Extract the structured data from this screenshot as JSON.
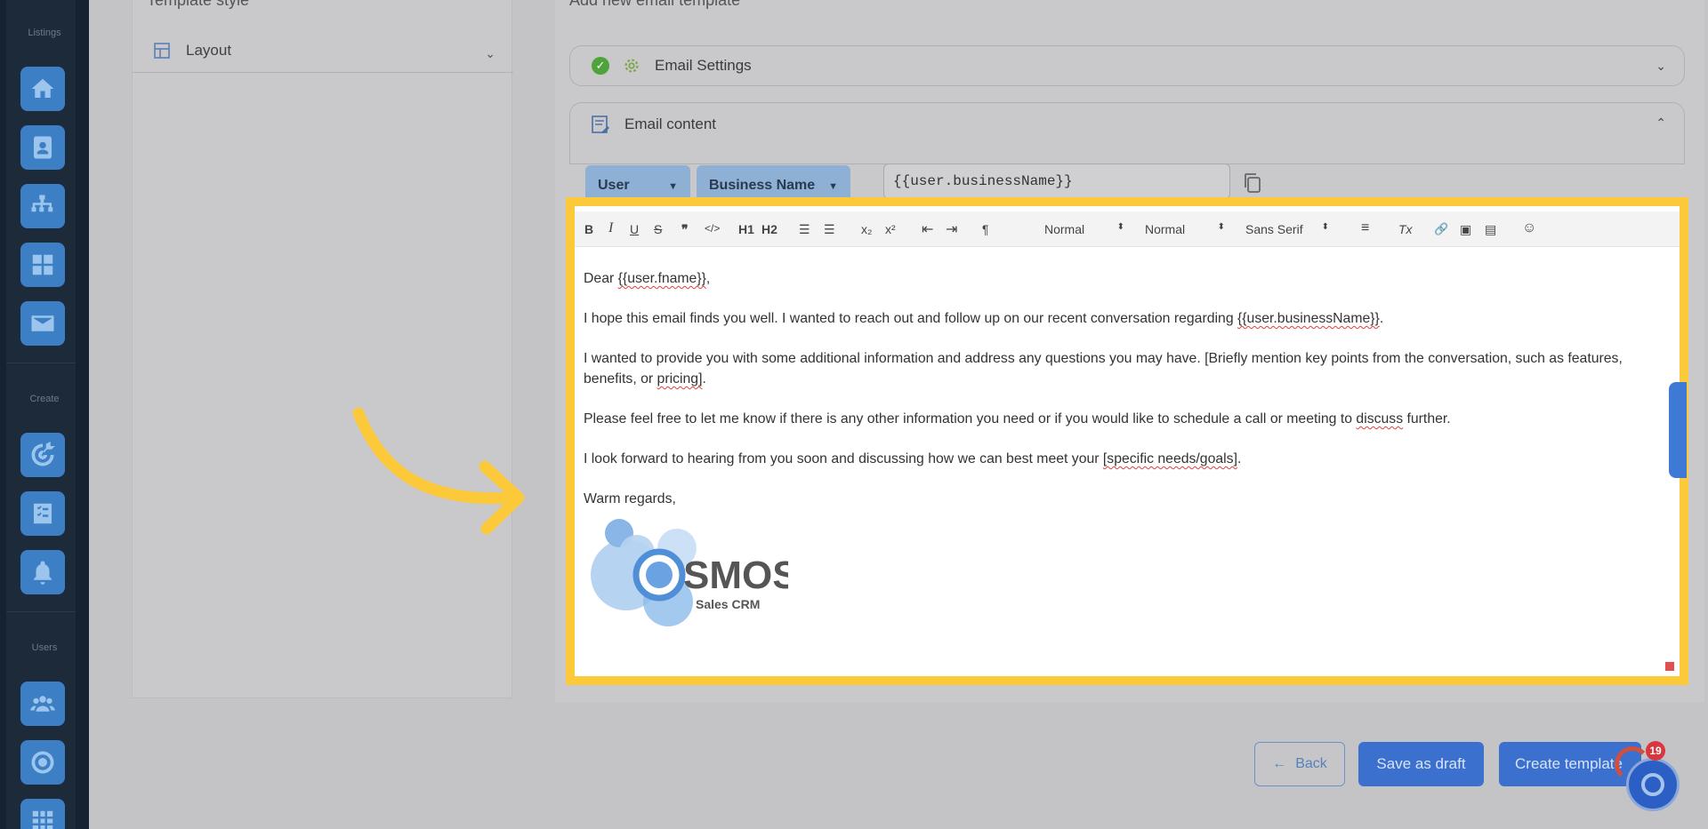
{
  "rail": {
    "sections": [
      "Listings",
      "Create",
      "Users"
    ],
    "listing_icons": [
      "home-icon",
      "contact-card-icon",
      "org-chart-icon",
      "dashboard-icon",
      "mail-icon"
    ],
    "create_icons": [
      "target-icon",
      "checklist-icon",
      "bell-icon"
    ],
    "user_icons": [
      "users-icon",
      "circle-target-icon",
      "grid-icon"
    ]
  },
  "left_panel": {
    "title": "Template style",
    "layout_label": "Layout"
  },
  "right_panel": {
    "title": "Add new email template",
    "email_settings_label": "Email Settings",
    "email_content_label": "Email content",
    "user_dropdown": "User",
    "field_dropdown": "Business Name",
    "variable_value": "{{user.businessName}}"
  },
  "toolbar": {
    "bold": "B",
    "italic": "I",
    "underline": "U",
    "strike": "S",
    "quote": "❞",
    "code": "</>",
    "h1": "H1",
    "h2": "H2",
    "ol": "☰",
    "ul": "☰",
    "sub": "x₂",
    "sup": "x²",
    "outdent": "⇤",
    "indent": "⇥",
    "rtl": "¶",
    "size_select": "Normal",
    "header_select": "Normal",
    "font_select": "Sans Serif",
    "align": "≡",
    "clean": "Tx",
    "link": "🔗",
    "image": "▣",
    "video": "▤",
    "emoji": "☺"
  },
  "email": {
    "greeting_pre": "Dear ",
    "greeting_var": "{{user.fname}}",
    "greeting_post": ",",
    "p1_pre": "I hope this email finds you well. I wanted to reach out and follow up on our recent conversation regarding ",
    "p1_var": "{{user.businessName}}",
    "p1_post": ".",
    "p2_pre": "I wanted to provide you with some additional information and address any questions you may have. [Briefly mention key points from the conversation, such as features, benefits, or ",
    "p2_sq": "pricing]",
    "p2_post": ".",
    "p3_pre": "Please feel free to let me know if there is any other information you need or if you would like to schedule a call or meeting to ",
    "p3_sq": "discuss",
    "p3_post": " further.",
    "p4_pre": "I look forward to hearing from you soon and discussing how we can best meet your ",
    "p4_sq": "[specific needs/goals]",
    "p4_post": ".",
    "signoff": "Warm regards,"
  },
  "logo": {
    "brand": "OSMOS",
    "tagline": "Sales CRM"
  },
  "actions": {
    "back": "Back",
    "save_draft": "Save as draft",
    "create": "Create template",
    "notif_count": "19"
  },
  "colors": {
    "highlight": "#fcc93a",
    "primary": "#3b70cf",
    "rail": "#152231"
  }
}
